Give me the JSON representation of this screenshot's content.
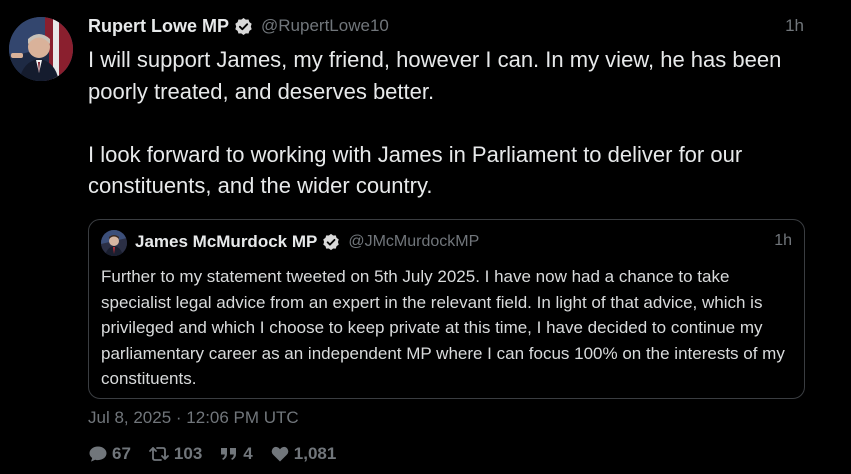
{
  "tweet": {
    "author": {
      "name": "Rupert Lowe MP",
      "handle": "@RupertLowe10",
      "verified": true
    },
    "time": "1h",
    "paragraphs": [
      "I will support James, my friend, however I can. In my view, he has been poorly treated, and deserves better.",
      "I look forward to working with James in Parliament to deliver for our constituents, and the wider country."
    ],
    "timestamp": "Jul 8, 2025 · 12:06 PM UTC",
    "stats": {
      "replies": "67",
      "retweets": "103",
      "quotes": "4",
      "likes": "1,081"
    }
  },
  "quoted_tweet": {
    "author": {
      "name": "James McMurdock MP",
      "handle": "@JMcMurdockMP",
      "verified": true
    },
    "time": "1h",
    "text": "Further to my statement tweeted on 5th July 2025. I have now had a chance to take specialist legal advice from an expert in the relevant field. In light of that advice, which is privileged and which I choose to keep private at this time, I have decided to continue my parliamentary career as an independent MP where I can focus 100% on the interests of my constituents."
  },
  "icons": {
    "verified": "verified-badge-icon",
    "reply": "comment-bubble-icon",
    "retweet": "retweet-icon",
    "quote": "quote-icon",
    "like": "heart-icon"
  },
  "colors": {
    "background": "#000000",
    "text": "#e7e9ea",
    "muted": "#71767b",
    "border": "#3a3d41"
  }
}
